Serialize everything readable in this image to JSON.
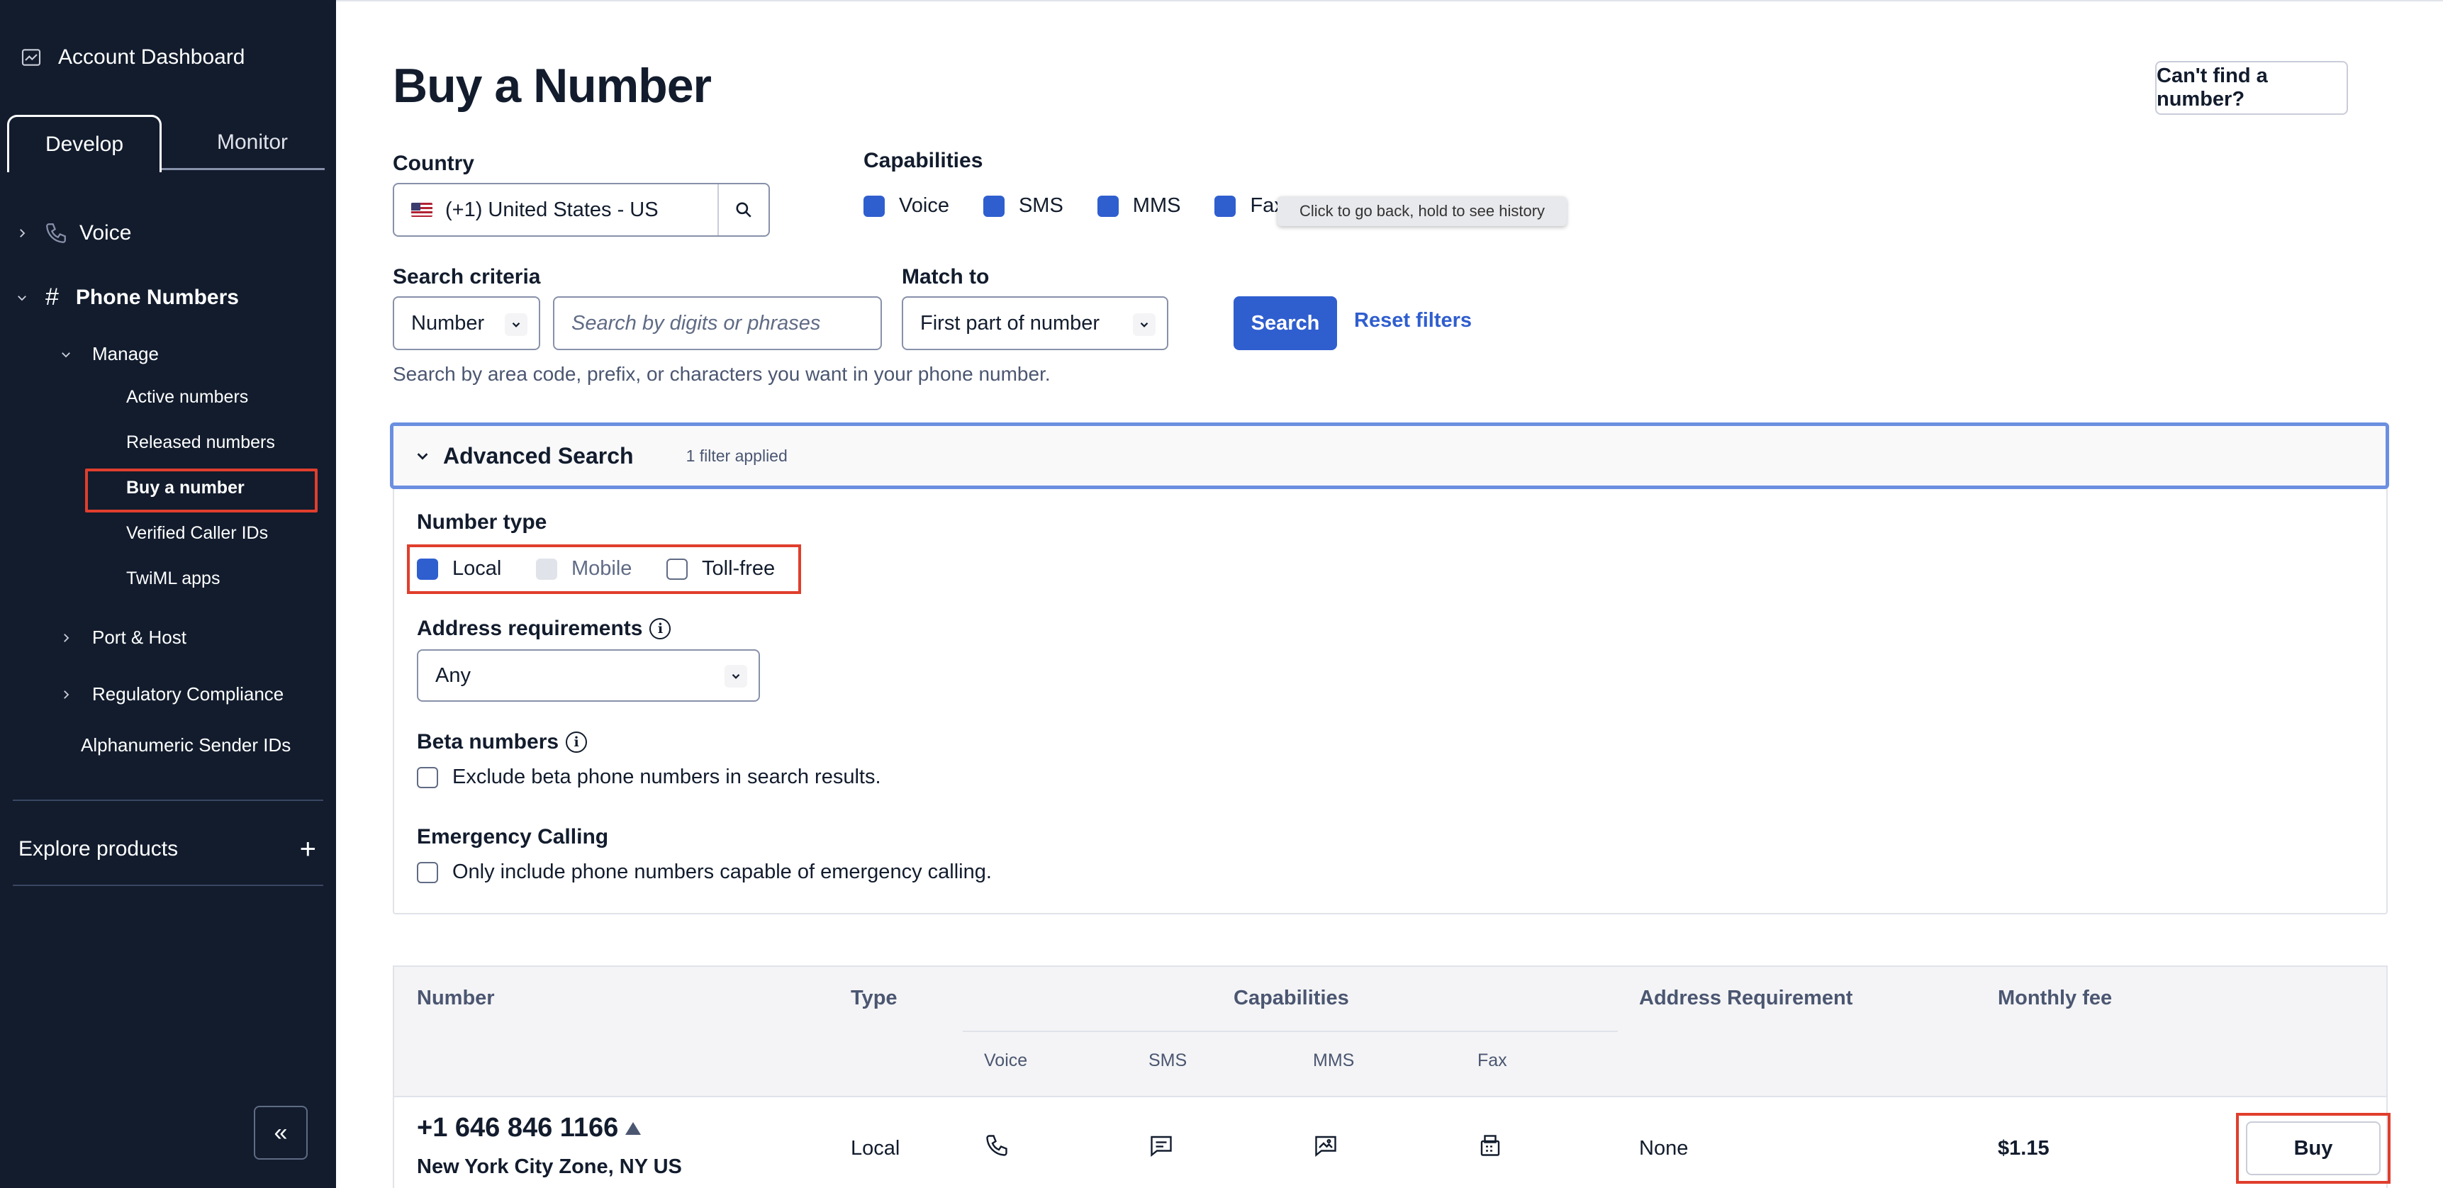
{
  "sidebar": {
    "account_dashboard": "Account Dashboard",
    "tabs": {
      "develop": "Develop",
      "monitor": "Monitor"
    },
    "voice": "Voice",
    "phone_numbers": "Phone Numbers",
    "manage": "Manage",
    "items": {
      "active": "Active numbers",
      "released": "Released numbers",
      "buy": "Buy a number",
      "verified": "Verified Caller IDs",
      "twiml": "TwiML apps"
    },
    "port_host": "Port & Host",
    "regulatory": "Regulatory Compliance",
    "alphanumeric": "Alphanumeric Sender IDs",
    "explore": "Explore products",
    "collapse_glyph": "«"
  },
  "page": {
    "title": "Buy a Number",
    "cant_find": "Can't find a number?"
  },
  "country": {
    "label": "Country",
    "value": "(+1) United States - US"
  },
  "capabilities": {
    "label": "Capabilities",
    "voice": "Voice",
    "sms": "SMS",
    "mms": "MMS",
    "fax": "Fax"
  },
  "tooltip": "Click to go back, hold to see history",
  "search": {
    "criteria_label": "Search criteria",
    "criteria_value": "Number",
    "input_placeholder": "Search by digits or phrases",
    "match_label": "Match to",
    "match_value": "First part of number",
    "search_button": "Search",
    "reset": "Reset filters",
    "help": "Search by area code, prefix, or characters you want in your phone number."
  },
  "advanced": {
    "title": "Advanced Search",
    "filters_applied": "1 filter applied",
    "number_type_label": "Number type",
    "local": "Local",
    "mobile": "Mobile",
    "tollfree": "Toll-free",
    "address_label": "Address requirements",
    "address_value": "Any",
    "beta_label": "Beta numbers",
    "beta_option": "Exclude beta phone numbers in search results.",
    "emergency_label": "Emergency Calling",
    "emergency_option": "Only include phone numbers capable of emergency calling."
  },
  "table": {
    "headers": {
      "number": "Number",
      "type": "Type",
      "capabilities": "Capabilities",
      "voice": "Voice",
      "sms": "SMS",
      "mms": "MMS",
      "fax": "Fax",
      "address": "Address Requirement",
      "fee": "Monthly fee"
    },
    "row": {
      "number": "+1 646 846 1166",
      "location": "New York City Zone, NY US",
      "type": "Local",
      "address": "None",
      "fee": "$1.15",
      "buy": "Buy"
    }
  },
  "colors": {
    "sidebar_bg": "#121c2d",
    "accent": "#2f5ecf",
    "highlight": "#e03e2d"
  }
}
